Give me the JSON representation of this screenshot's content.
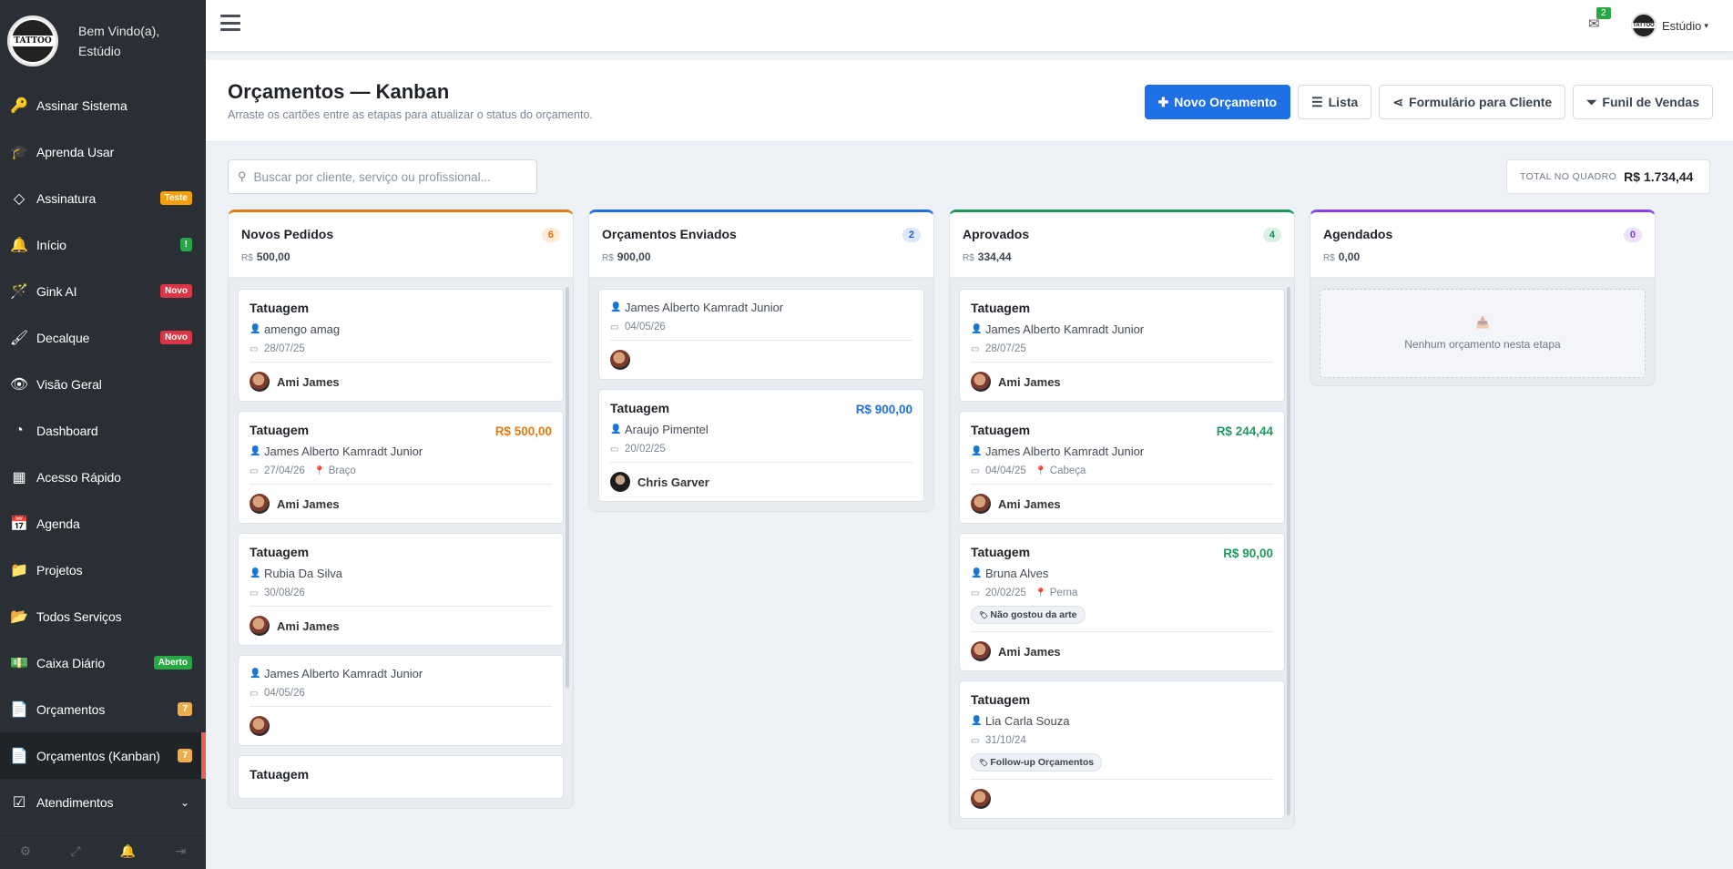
{
  "sidebar": {
    "welcome_line1": "Bem Vindo(a),",
    "welcome_line2": "Estúdio",
    "logo_text": "TATTOO",
    "items": [
      {
        "label": "Assinar Sistema",
        "icon": "key-icon",
        "glyph": "🔑",
        "badge": ""
      },
      {
        "label": "Aprenda Usar",
        "icon": "graduation-cap-icon",
        "glyph": "🎓",
        "badge": ""
      },
      {
        "label": "Assinatura",
        "icon": "diamond-icon",
        "glyph": "◇",
        "badge": "Teste"
      },
      {
        "label": "Início",
        "icon": "bell-icon",
        "glyph": "🔔",
        "badge": "!"
      },
      {
        "label": "Gink AI",
        "icon": "magic-wand-icon",
        "glyph": "🪄",
        "badge": "Novo"
      },
      {
        "label": "Decalque",
        "icon": "paint-brush-icon",
        "glyph": "🖌",
        "badge": "Novo"
      },
      {
        "label": "Visão Geral",
        "icon": "eye-icon",
        "glyph": "👁",
        "badge": ""
      },
      {
        "label": "Dashboard",
        "icon": "dashboard-gauge-icon",
        "glyph": "◔",
        "badge": ""
      },
      {
        "label": "Acesso Rápido",
        "icon": "grid-icon",
        "glyph": "▦",
        "badge": ""
      },
      {
        "label": "Agenda",
        "icon": "calendar-icon",
        "glyph": "📅",
        "badge": ""
      },
      {
        "label": "Projetos",
        "icon": "folder-icon",
        "glyph": "📁",
        "badge": ""
      },
      {
        "label": "Todos Serviços",
        "icon": "folder-open-icon",
        "glyph": "📂",
        "badge": ""
      },
      {
        "label": "Caixa Diário",
        "icon": "money-icon",
        "glyph": "💵",
        "badge": "Aberto"
      },
      {
        "label": "Orçamentos",
        "icon": "document-icon",
        "glyph": "📄",
        "badge": "7"
      },
      {
        "label": "Orçamentos (Kanban)",
        "icon": "document-icon",
        "glyph": "📄",
        "badge": "7"
      },
      {
        "label": "Atendimentos",
        "icon": "check-square-icon",
        "glyph": "☑",
        "badge": ""
      }
    ]
  },
  "topbar": {
    "mail_count": "2",
    "user_name": "Estúdio"
  },
  "page": {
    "title": "Orçamentos — Kanban",
    "subtitle": "Arraste os cartões entre as etapas para atualizar o status do orçamento.",
    "buttons": {
      "novo": "Novo Orçamento",
      "lista": "Lista",
      "formulario": "Formulário para Cliente",
      "funil": "Funil de Vendas"
    },
    "search_placeholder": "Buscar por cliente, serviço ou profissional...",
    "total_label": "TOTAL NO QUADRO",
    "total_value": "R$ 1.734,44"
  },
  "columns": [
    {
      "title": "Novos Pedidos",
      "currency": "R$",
      "sum": "500,00",
      "count": "6",
      "accent": "#e07b12",
      "count_bg": "#fdebd5",
      "count_color": "#d9730d",
      "cards": [
        {
          "title": "Tatuagem",
          "price": "",
          "client": "amengo amag",
          "date": "28/07/25",
          "place": "",
          "tag": "",
          "artist": "Ami James"
        },
        {
          "title": "Tatuagem",
          "price": "R$ 500,00",
          "client": "James Alberto Kamradt Junior",
          "date": "27/04/26",
          "place": "Braço",
          "tag": "",
          "artist": "Ami James"
        },
        {
          "title": "Tatuagem",
          "price": "",
          "client": "Rubia Da Silva",
          "date": "30/08/26",
          "place": "",
          "tag": "",
          "artist": "Ami James"
        },
        {
          "title": "",
          "price": "",
          "client": "James Alberto Kamradt Junior",
          "date": "04/05/26",
          "place": "",
          "tag": "",
          "artist": ""
        },
        {
          "title": "Tatuagem",
          "price": "",
          "client": "",
          "date": "",
          "place": "",
          "tag": "",
          "artist": ""
        }
      ]
    },
    {
      "title": "Orçamentos Enviados",
      "currency": "R$",
      "sum": "900,00",
      "count": "2",
      "accent": "#1f6fe5",
      "count_bg": "#dde8fb",
      "count_color": "#1f5fcf",
      "cards": [
        {
          "title": "",
          "price": "",
          "client": "James Alberto Kamradt Junior",
          "date": "04/05/26",
          "place": "",
          "tag": "",
          "artist": ""
        },
        {
          "title": "Tatuagem",
          "price": "R$ 900,00",
          "client": "Araujo Pimentel",
          "date": "20/02/25",
          "place": "",
          "tag": "",
          "artist": "Chris Garver"
        }
      ]
    },
    {
      "title": "Aprovados",
      "currency": "R$",
      "sum": "334,44",
      "count": "4",
      "accent": "#1e9a5f",
      "count_bg": "#d8f1e4",
      "count_color": "#1a8a54",
      "cards": [
        {
          "title": "Tatuagem",
          "price": "",
          "client": "James Alberto Kamradt Junior",
          "date": "28/07/25",
          "place": "",
          "tag": "",
          "artist": "Ami James"
        },
        {
          "title": "Tatuagem",
          "price": "R$ 244,44",
          "client": "James Alberto Kamradt Junior",
          "date": "04/04/25",
          "place": "Cabeça",
          "tag": "",
          "artist": "Ami James"
        },
        {
          "title": "Tatuagem",
          "price": "R$ 90,00",
          "client": "Bruna Alves",
          "date": "20/02/25",
          "place": "Perna",
          "tag": "Não gostou da arte",
          "artist": "Ami James"
        },
        {
          "title": "Tatuagem",
          "price": "",
          "client": "Lia Carla Souza",
          "date": "31/10/24",
          "place": "",
          "tag": "Follow-up Orçamentos",
          "artist": ""
        }
      ]
    },
    {
      "title": "Agendados",
      "currency": "R$",
      "sum": "0,00",
      "count": "0",
      "accent": "#8a3ff0",
      "count_bg": "#ece2fc",
      "count_color": "#7a3be0",
      "empty_text": "Nenhum orçamento nesta etapa",
      "cards": []
    }
  ]
}
